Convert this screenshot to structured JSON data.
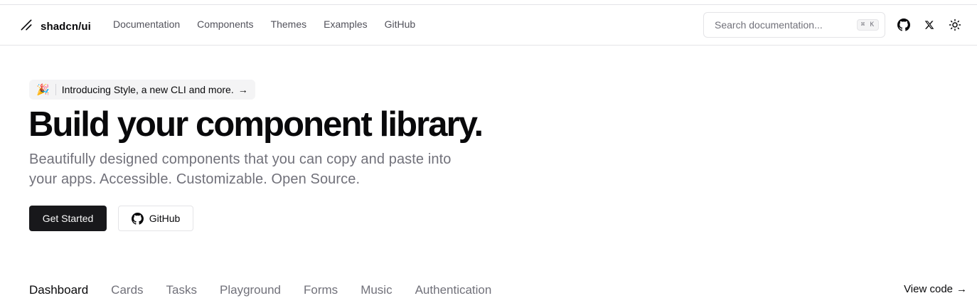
{
  "header": {
    "logo_text": "shadcn/ui",
    "nav": [
      {
        "label": "Documentation"
      },
      {
        "label": "Components"
      },
      {
        "label": "Themes"
      },
      {
        "label": "Examples"
      },
      {
        "label": "GitHub"
      }
    ],
    "search": {
      "placeholder": "Search documentation...",
      "shortcut": "⌘ K"
    },
    "icons": [
      "github-icon",
      "x-icon",
      "sun-icon"
    ]
  },
  "hero": {
    "announcement": {
      "emoji": "🎉",
      "text": "Introducing Style, a new CLI and more.",
      "arrow": "→"
    },
    "title": "Build your component library.",
    "subtitle": "Beautifully designed components that you can copy and paste into your apps. Accessible. Customizable. Open Source.",
    "primary_button": "Get Started",
    "secondary_button": "GitHub"
  },
  "examples": {
    "tabs": [
      {
        "label": "Dashboard",
        "active": true
      },
      {
        "label": "Cards",
        "active": false
      },
      {
        "label": "Tasks",
        "active": false
      },
      {
        "label": "Playground",
        "active": false
      },
      {
        "label": "Forms",
        "active": false
      },
      {
        "label": "Music",
        "active": false
      },
      {
        "label": "Authentication",
        "active": false
      }
    ],
    "view_code": "View code",
    "view_code_arrow": "→"
  },
  "colors": {
    "primary": "#18181b",
    "muted_text": "#71717a",
    "border": "#e4e4e7",
    "muted_bg": "#f4f4f5"
  }
}
